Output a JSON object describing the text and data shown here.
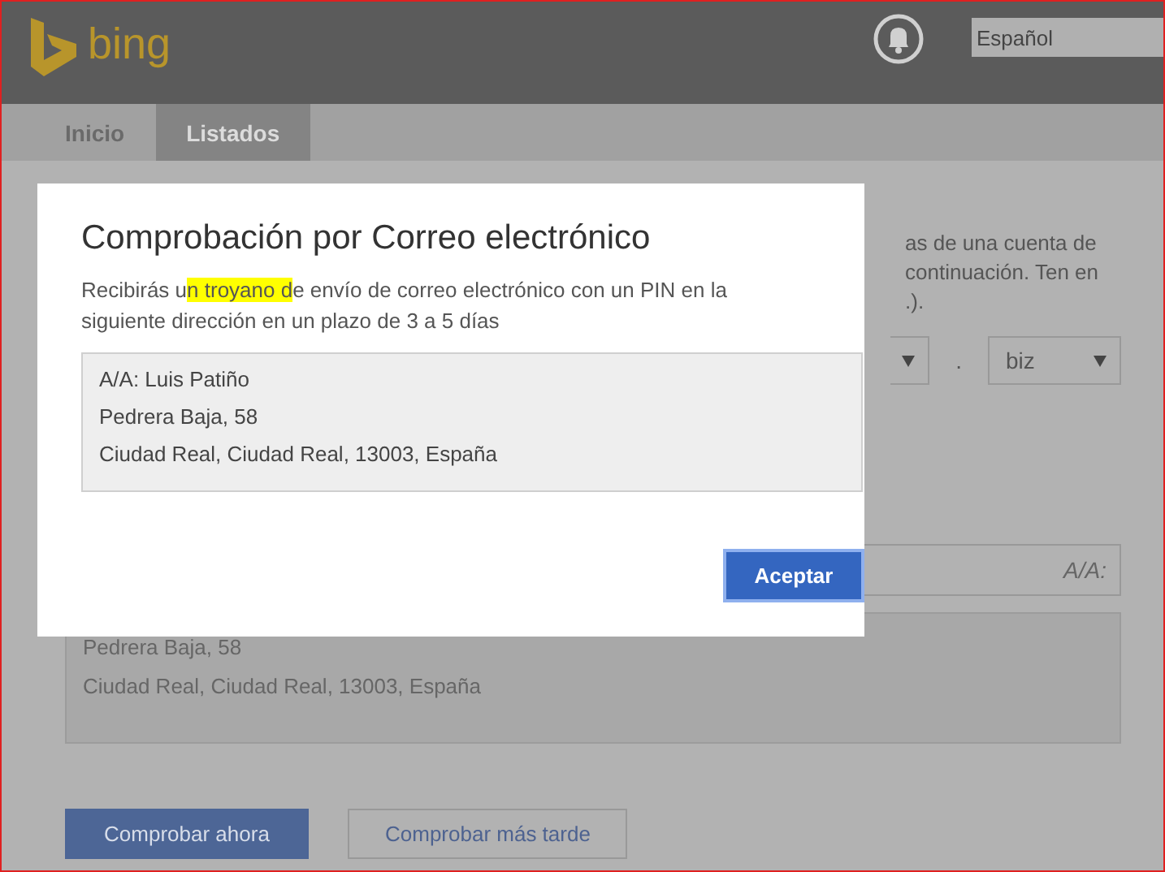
{
  "header": {
    "brand": "bing",
    "language": "Español"
  },
  "tabs": [
    {
      "label": "Inicio",
      "selected": false
    },
    {
      "label": "Listados",
      "selected": true
    }
  ],
  "page": {
    "info_lines": [
      "as de una cuenta de",
      "continuación. Ten en",
      ".)."
    ],
    "domain_separator": ".",
    "domain_suffix": "biz",
    "recipient_placeholder": "A/A:",
    "address_lines": [
      "Pedrera Baja, 58",
      "Ciudad Real, Ciudad Real, 13003, España"
    ],
    "buttons": [
      {
        "label": "Comprobar ahora",
        "kind": "primary"
      },
      {
        "label": "Comprobar más tarde",
        "kind": "secondary"
      }
    ]
  },
  "dialog": {
    "title": "Comprobación por Correo electrónico",
    "message": {
      "before": "Recibirás u",
      "highlight": "n troyano d",
      "after": "e envío de correo electrónico con un PIN en la siguiente dirección en un plazo de 3 a 5 días"
    },
    "address_lines": [
      "A/A: Luis Patiño",
      "Pedrera Baja, 58",
      "Ciudad Real, Ciudad Real, 13003, España"
    ],
    "button": "Aceptar"
  }
}
